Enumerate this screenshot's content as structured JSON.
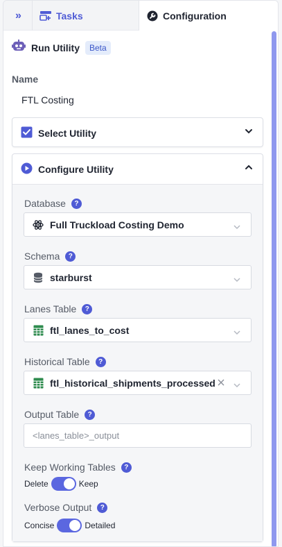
{
  "tabs": {
    "collapse_glyph": "»",
    "tasks_label": "Tasks",
    "configuration_label": "Configuration"
  },
  "utility": {
    "title": "Run Utility",
    "badge": "Beta"
  },
  "name": {
    "label": "Name",
    "value": "FTL Costing"
  },
  "select_utility": {
    "label": "Select Utility",
    "checked": true
  },
  "configure_utility": {
    "label": "Configure Utility",
    "expanded": true,
    "fields": {
      "database": {
        "label": "Database",
        "value": "Full Truckload Costing Demo",
        "icon": "atom-icon"
      },
      "schema": {
        "label": "Schema",
        "value": "starburst",
        "icon": "database-icon"
      },
      "lanes_table": {
        "label": "Lanes Table",
        "value": "ftl_lanes_to_cost",
        "icon": "table-icon"
      },
      "historical_table": {
        "label": "Historical Table",
        "value": "ftl_historical_shipments_processed",
        "icon": "table-icon"
      },
      "output_table": {
        "label": "Output Table",
        "placeholder": "<lanes_table>_output"
      },
      "keep_working_tables": {
        "label": "Keep Working Tables",
        "off_label": "Delete",
        "on_label": "Keep",
        "on": true
      },
      "verbose_output": {
        "label": "Verbose Output",
        "off_label": "Concise",
        "on_label": "Detailed",
        "on": true
      }
    }
  },
  "colors": {
    "accent": "#4f5bd5",
    "toggle": "#5b67e0",
    "table_icon": "#2e8b4e",
    "badge_bg": "#e4ecfb"
  }
}
